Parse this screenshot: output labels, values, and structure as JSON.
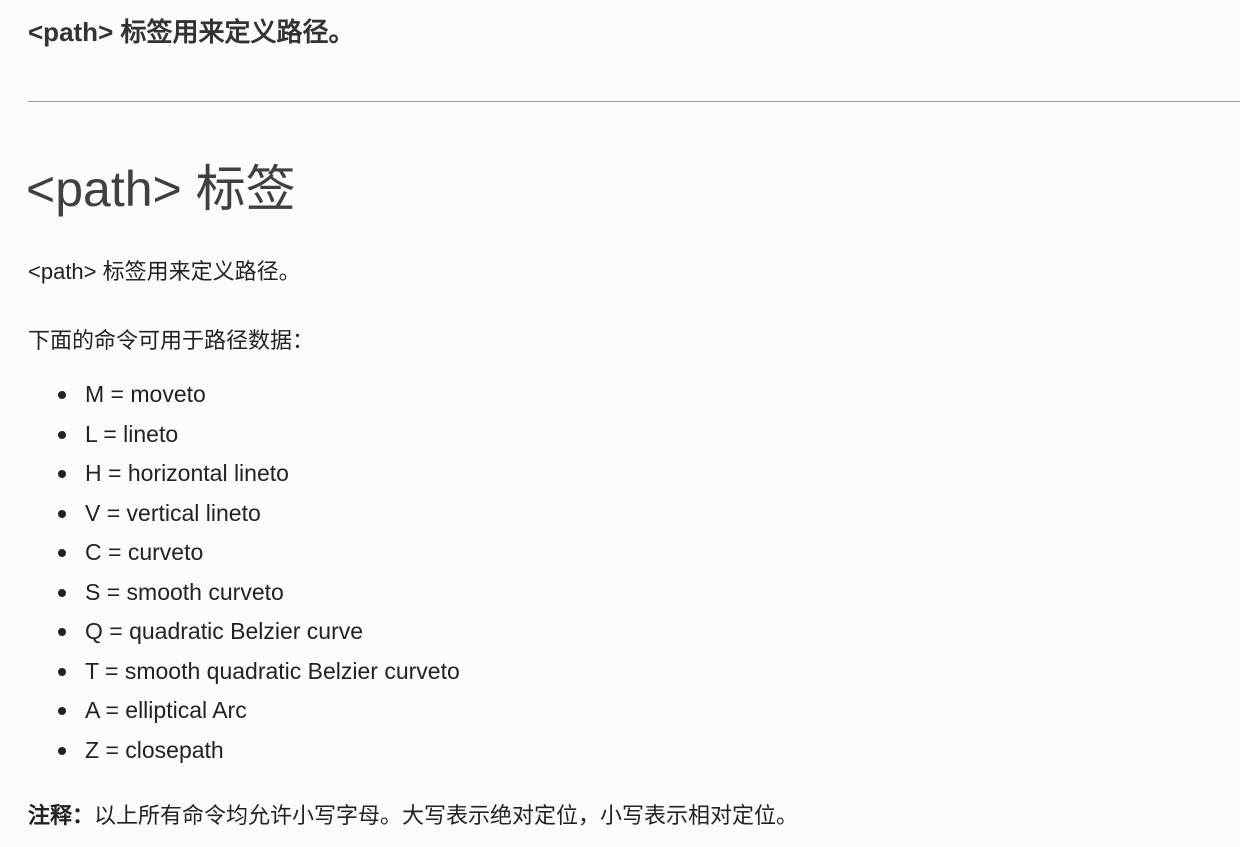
{
  "intro": {
    "bold_text": "<path> 标签用来定义路径。"
  },
  "section": {
    "title": "<path> 标签",
    "paragraph_1": "<path> 标签用来定义路径。",
    "paragraph_2": "下面的命令可用于路径数据：",
    "commands": [
      "M = moveto",
      "L = lineto",
      "H = horizontal lineto",
      "V = vertical lineto",
      "C = curveto",
      "S = smooth curveto",
      "Q = quadratic Belzier curve",
      "T = smooth quadratic Belzier curveto",
      "A = elliptical Arc",
      "Z = closepath"
    ],
    "note": {
      "label": "注释：",
      "text": "以上所有命令均允许小写字母。大写表示绝对定位，小写表示相对定位。"
    }
  }
}
